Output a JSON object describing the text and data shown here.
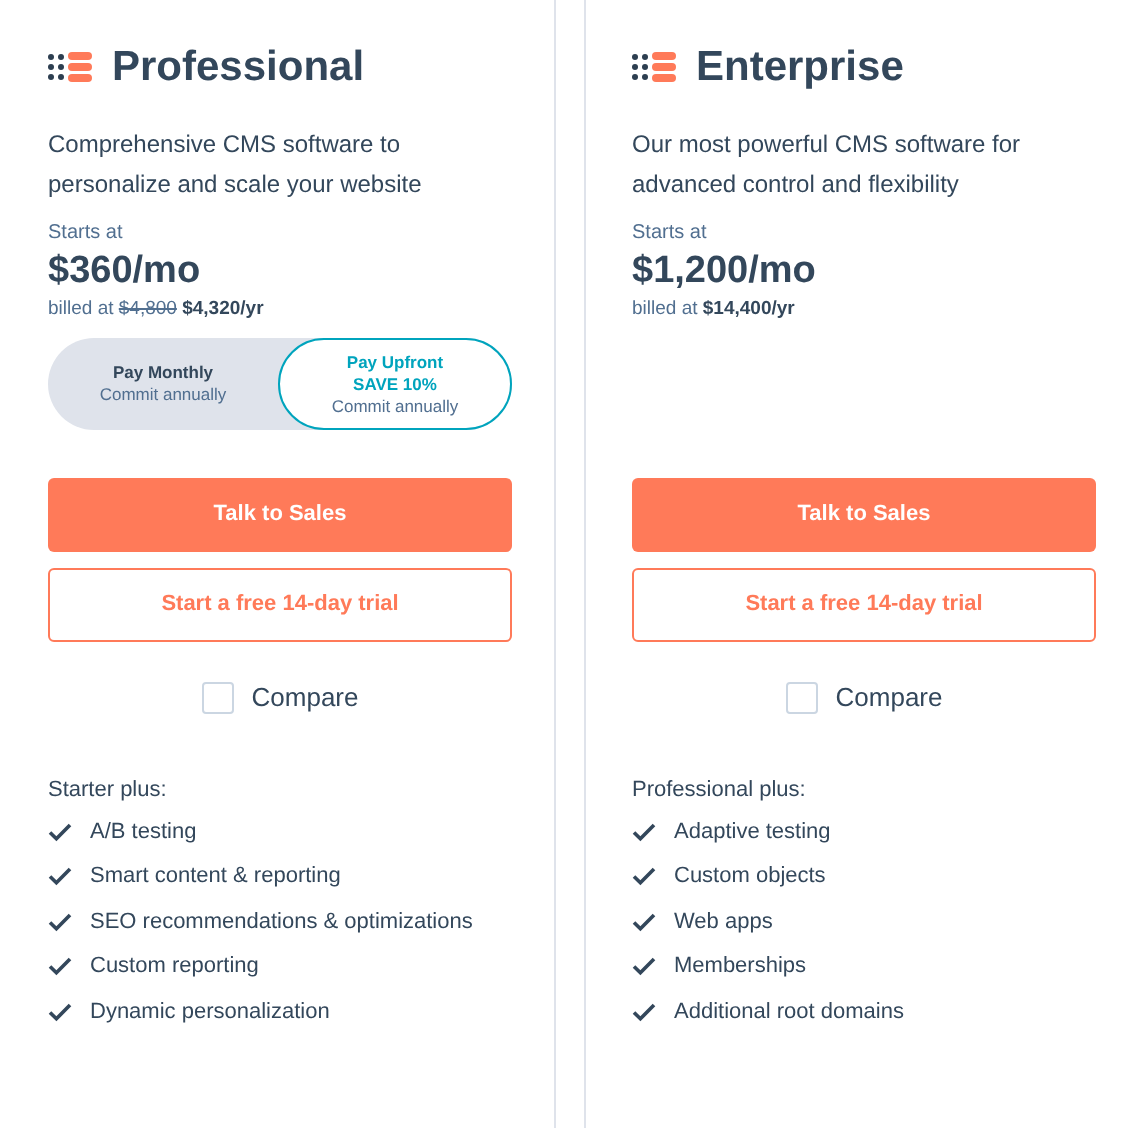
{
  "plans": [
    {
      "name": "Professional",
      "description": "Comprehensive CMS software to personalize and scale your website",
      "starts_label": "Starts at",
      "price": "$360/mo",
      "billed_prefix": "billed at",
      "billed_old": "$4,800",
      "billed_amount": "$4,320/yr",
      "billing_options": [
        {
          "title": "Pay Monthly",
          "note": "Commit annually",
          "selected": false
        },
        {
          "title": "Pay Upfront",
          "badge": "SAVE 10%",
          "note": "Commit annually",
          "selected": true
        }
      ],
      "primary_button": "Talk to Sales",
      "secondary_button": "Start a free 14-day trial",
      "compare": {
        "label": "Compare",
        "checked": false
      },
      "features_heading": "Starter plus:",
      "features": [
        "A/B testing",
        "Smart content & reporting",
        "SEO recommendations & optimizations",
        "Custom reporting",
        "Dynamic personalization"
      ]
    },
    {
      "name": "Enterprise",
      "description": "Our most powerful CMS software for advanced control and flexibility",
      "starts_label": "Starts at",
      "price": "$1,200/mo",
      "billed_prefix": "billed at",
      "billed_amount": "$14,400/yr",
      "primary_button": "Talk to Sales",
      "secondary_button": "Start a free 14-day trial",
      "compare": {
        "label": "Compare",
        "checked": false
      },
      "features_heading": "Professional plus:",
      "features": [
        "Adaptive testing",
        "Custom objects",
        "Web apps",
        "Memberships",
        "Additional root domains"
      ]
    }
  ]
}
